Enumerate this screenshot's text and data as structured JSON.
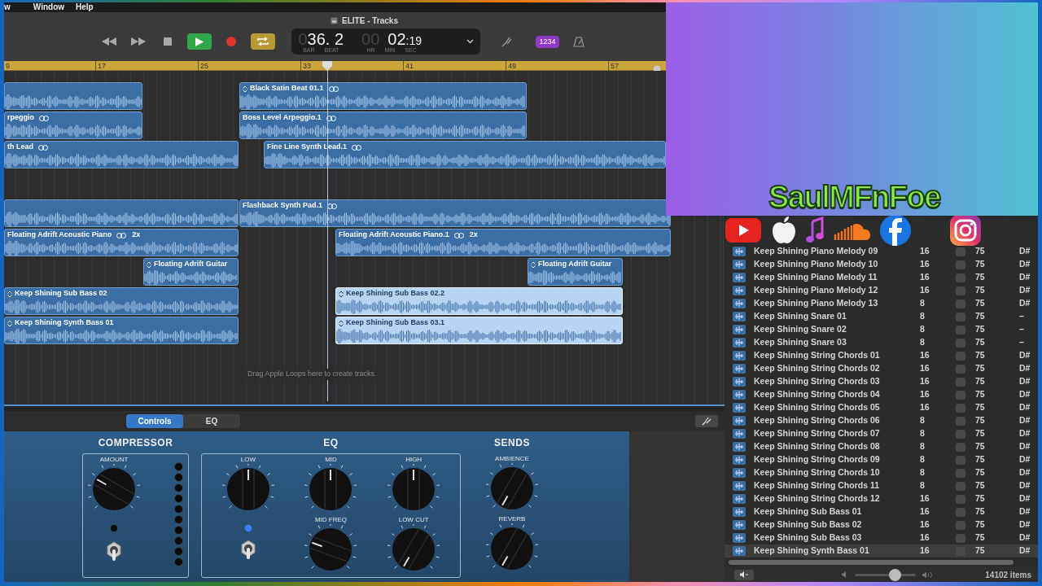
{
  "menu": [
    "w",
    "Window",
    "Help"
  ],
  "window": {
    "title": "ELITE - Tracks"
  },
  "transport": {
    "playing": true,
    "cycle": true,
    "lcd": {
      "bar_dim": "0",
      "bar": "36. 2",
      "bar_label": "BAR",
      "beat_label": "BEAT",
      "hr_dim": "00",
      "time": "02",
      "sec": ":19",
      "hr_label": "HR",
      "min_label": "MIN",
      "sec_label": "SEC"
    },
    "count_in": "1234"
  },
  "ruler": [
    "9",
    "17",
    "25",
    "33",
    "41",
    "49",
    "57"
  ],
  "tracks": [
    {
      "regions": [
        {
          "loop": false,
          "chevron": false,
          "selected": false
        },
        {
          "name": "Black Satin Beat 01.1",
          "loop": true,
          "chevron": true,
          "selected": false
        }
      ]
    },
    {
      "regions": [
        {
          "name": "rpeggio",
          "loop": true,
          "chevron": false,
          "selected": false
        },
        {
          "name": "Boss Level Arpeggio.1",
          "loop": true,
          "chevron": false,
          "selected": false
        }
      ]
    },
    {
      "regions": [
        {
          "name": "th Lead",
          "loop": true,
          "chevron": false,
          "selected": false
        },
        {
          "name": "Fine Line Synth Lead.1",
          "loop": true,
          "chevron": false,
          "selected": false
        }
      ]
    },
    {
      "regions": [
        {
          "loop": false,
          "chevron": false,
          "selected": false
        },
        {
          "name": "Flashback Synth Pad.1",
          "loop": true,
          "chevron": false,
          "selected": false
        }
      ]
    },
    {
      "regions": [
        {
          "name": "Floating Adrift Acoustic Piano",
          "loop": true,
          "repeat": "2x",
          "chevron": false,
          "selected": false
        },
        {
          "name": "Floating Adrift Acoustic Piano.1",
          "loop": true,
          "repeat": "2x",
          "chevron": false,
          "selected": false
        }
      ]
    },
    {
      "regions": [
        {
          "name": "Floating Adrift Guitar",
          "loop": false,
          "chevron": true,
          "selected": false
        },
        {
          "name": "Floating Adrift Guitar",
          "loop": false,
          "chevron": true,
          "selected": false
        }
      ]
    },
    {
      "regions": [
        {
          "name": "Keep Shining Sub Bass 02",
          "loop": false,
          "chevron": true,
          "selected": false
        },
        {
          "name": "Keep Shining Sub Bass 02.2",
          "loop": false,
          "chevron": true,
          "selected": true
        }
      ]
    },
    {
      "regions": [
        {
          "name": "Keep Shining Synth Bass 01",
          "loop": false,
          "chevron": true,
          "selected": false
        },
        {
          "name": "Keep Shining Sub Bass 03.1",
          "loop": false,
          "chevron": true,
          "selected": true
        }
      ]
    }
  ],
  "drop_hint": "Drag Apple Loops here to create tracks.",
  "editor": {
    "tabs": [
      {
        "label": "Controls",
        "selected": true
      },
      {
        "label": "EQ",
        "selected": false
      }
    ],
    "compressor": {
      "title": "COMPRESSOR",
      "knob": {
        "label": "AMOUNT"
      },
      "switch": {
        "on": false
      },
      "meter": [
        {
          "on": false
        },
        {
          "on": false
        },
        {
          "on": false
        },
        {
          "on": false
        },
        {
          "on": false
        },
        {
          "on": false
        },
        {
          "on": false
        },
        {
          "on": false
        },
        {
          "on": false
        },
        {
          "on": false
        }
      ],
      "led": {
        "on": false
      }
    },
    "eq": {
      "title": "EQ",
      "knobs": [
        {
          "label": "LOW"
        },
        {
          "label": "MID"
        },
        {
          "label": "HIGH"
        },
        {
          "label": "MID FREQ"
        },
        {
          "label": "LOW CUT"
        }
      ],
      "led": {
        "on": true
      },
      "switch": {
        "on": false
      }
    },
    "sends": {
      "title": "SENDS",
      "knobs": [
        {
          "label": "AMBIENCE"
        },
        {
          "label": "REVERB"
        }
      ]
    }
  },
  "loops": {
    "rows": [
      {
        "name": "Keep Shining Piano Melody 09",
        "beats": "16",
        "favorite": false,
        "tempo": "75",
        "key": "D#",
        "selected": false
      },
      {
        "name": "Keep Shining Piano Melody 10",
        "beats": "16",
        "favorite": false,
        "tempo": "75",
        "key": "D#",
        "selected": false
      },
      {
        "name": "Keep Shining Piano Melody 11",
        "beats": "16",
        "favorite": false,
        "tempo": "75",
        "key": "D#",
        "selected": false
      },
      {
        "name": "Keep Shining Piano Melody 12",
        "beats": "16",
        "favorite": false,
        "tempo": "75",
        "key": "D#",
        "selected": false
      },
      {
        "name": "Keep Shining Piano Melody 13",
        "beats": "8",
        "favorite": false,
        "tempo": "75",
        "key": "D#",
        "selected": false
      },
      {
        "name": "Keep Shining Snare 01",
        "beats": "8",
        "favorite": false,
        "tempo": "75",
        "key": "–",
        "selected": false
      },
      {
        "name": "Keep Shining Snare 02",
        "beats": "8",
        "favorite": false,
        "tempo": "75",
        "key": "–",
        "selected": false
      },
      {
        "name": "Keep Shining Snare 03",
        "beats": "8",
        "favorite": false,
        "tempo": "75",
        "key": "–",
        "selected": false
      },
      {
        "name": "Keep Shining String Chords 01",
        "beats": "16",
        "favorite": false,
        "tempo": "75",
        "key": "D#",
        "selected": false
      },
      {
        "name": "Keep Shining String Chords 02",
        "beats": "16",
        "favorite": false,
        "tempo": "75",
        "key": "D#",
        "selected": false
      },
      {
        "name": "Keep Shining String Chords 03",
        "beats": "16",
        "favorite": false,
        "tempo": "75",
        "key": "D#",
        "selected": false
      },
      {
        "name": "Keep Shining String Chords 04",
        "beats": "16",
        "favorite": false,
        "tempo": "75",
        "key": "D#",
        "selected": false
      },
      {
        "name": "Keep Shining String Chords 05",
        "beats": "16",
        "favorite": false,
        "tempo": "75",
        "key": "D#",
        "selected": false
      },
      {
        "name": "Keep Shining String Chords 06",
        "beats": "8",
        "favorite": false,
        "tempo": "75",
        "key": "D#",
        "selected": false
      },
      {
        "name": "Keep Shining String Chords 07",
        "beats": "8",
        "favorite": false,
        "tempo": "75",
        "key": "D#",
        "selected": false
      },
      {
        "name": "Keep Shining String Chords 08",
        "beats": "8",
        "favorite": false,
        "tempo": "75",
        "key": "D#",
        "selected": false
      },
      {
        "name": "Keep Shining String Chords 09",
        "beats": "8",
        "favorite": false,
        "tempo": "75",
        "key": "D#",
        "selected": false
      },
      {
        "name": "Keep Shining String Chords 10",
        "beats": "8",
        "favorite": false,
        "tempo": "75",
        "key": "D#",
        "selected": false
      },
      {
        "name": "Keep Shining String Chords 11",
        "beats": "8",
        "favorite": false,
        "tempo": "75",
        "key": "D#",
        "selected": false
      },
      {
        "name": "Keep Shining String Chords 12",
        "beats": "16",
        "favorite": false,
        "tempo": "75",
        "key": "D#",
        "selected": false
      },
      {
        "name": "Keep Shining Sub Bass 01",
        "beats": "16",
        "favorite": false,
        "tempo": "75",
        "key": "D#",
        "selected": false
      },
      {
        "name": "Keep Shining Sub Bass 02",
        "beats": "16",
        "favorite": false,
        "tempo": "75",
        "key": "D#",
        "selected": false
      },
      {
        "name": "Keep Shining Sub Bass 03",
        "beats": "16",
        "favorite": false,
        "tempo": "75",
        "key": "D#",
        "selected": false
      },
      {
        "name": "Keep Shining Synth Bass 01",
        "beats": "16",
        "favorite": false,
        "tempo": "75",
        "key": "D#",
        "selected": true
      }
    ],
    "volume": {
      "level": 0.65
    },
    "count": "14102 items"
  },
  "overlay": {
    "channel_name": "SaulMFnFoe"
  }
}
